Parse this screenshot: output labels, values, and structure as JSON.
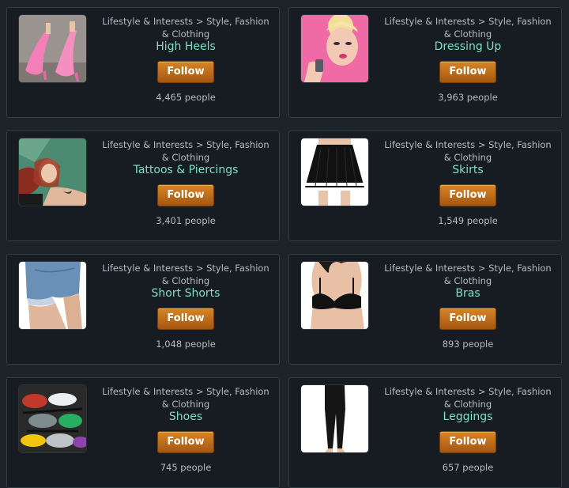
{
  "cards": [
    {
      "category": "Lifestyle & Interests > Style, Fashion & Clothing",
      "title": "High Heels",
      "follow": "Follow",
      "count": "4,465 people",
      "image": "pink-high-heels-photo"
    },
    {
      "category": "Lifestyle & Interests > Style, Fashion & Clothing",
      "title": "Dressing Up",
      "follow": "Follow",
      "count": "3,963 people",
      "image": "woman-makeup-photo"
    },
    {
      "category": "Lifestyle & Interests > Style, Fashion & Clothing",
      "title": "Tattoos & Piercings",
      "follow": "Follow",
      "count": "3,401 people",
      "image": "tattooed-woman-photo"
    },
    {
      "category": "Lifestyle & Interests > Style, Fashion & Clothing",
      "title": "Skirts",
      "follow": "Follow",
      "count": "1,549 people",
      "image": "pleated-skirt-photo"
    },
    {
      "category": "Lifestyle & Interests > Style, Fashion & Clothing",
      "title": "Short Shorts",
      "follow": "Follow",
      "count": "1,048 people",
      "image": "denim-shorts-photo"
    },
    {
      "category": "Lifestyle & Interests > Style, Fashion & Clothing",
      "title": "Bras",
      "follow": "Follow",
      "count": "893 people",
      "image": "black-bra-photo"
    },
    {
      "category": "Lifestyle & Interests > Style, Fashion & Clothing",
      "title": "Shoes",
      "follow": "Follow",
      "count": "745 people",
      "image": "pile-of-shoes-photo"
    },
    {
      "category": "Lifestyle & Interests > Style, Fashion & Clothing",
      "title": "Leggings",
      "follow": "Follow",
      "count": "657 people",
      "image": "black-leggings-photo"
    }
  ]
}
